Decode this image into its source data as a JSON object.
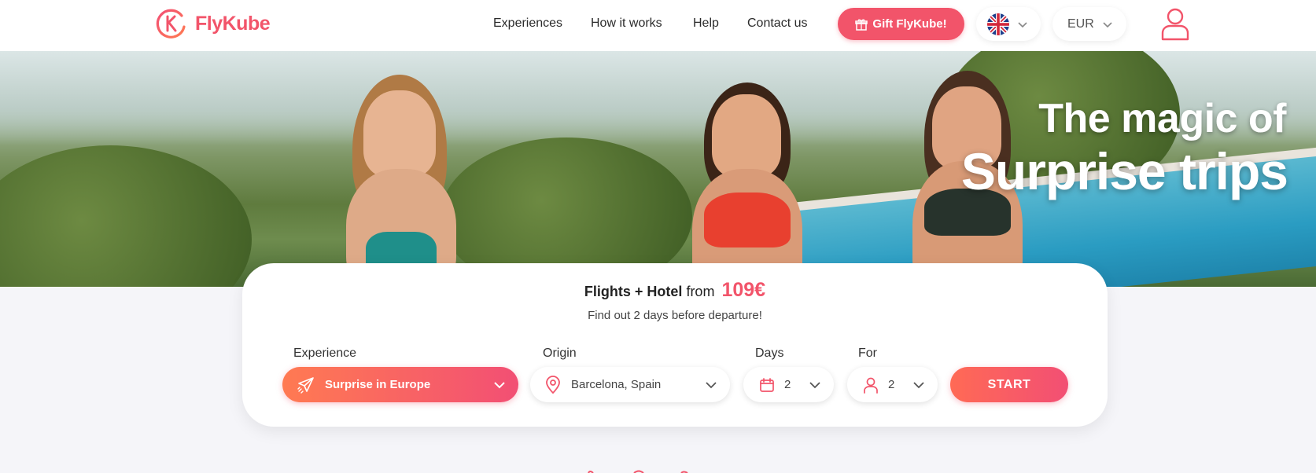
{
  "brand": {
    "name": "FlyKube",
    "color": "#f2546a"
  },
  "nav": {
    "items": [
      {
        "label": "Experiences"
      },
      {
        "label": "How it works"
      },
      {
        "label": "Help"
      },
      {
        "label": "Contact us"
      }
    ],
    "gift_label": "Gift FlyKube!",
    "language_icon": "uk-flag-icon",
    "currency": "EUR",
    "user_icon": "user-icon"
  },
  "hero": {
    "title_line1": "The magic of",
    "title_line2": "Surprise trips"
  },
  "search": {
    "headline_bold": "Flights + Hotel",
    "headline_from": "from",
    "price": "109€",
    "subtitle": "Find out 2 days before departure!",
    "experience": {
      "label": "Experience",
      "value": "Surprise in Europe",
      "icon": "plane-icon"
    },
    "origin": {
      "label": "Origin",
      "value": "Barcelona, Spain",
      "icon": "location-pin-icon"
    },
    "days": {
      "label": "Days",
      "value": "2",
      "icon": "calendar-icon"
    },
    "for": {
      "label": "For",
      "value": "2",
      "icon": "person-icon"
    },
    "start_label": "START"
  }
}
